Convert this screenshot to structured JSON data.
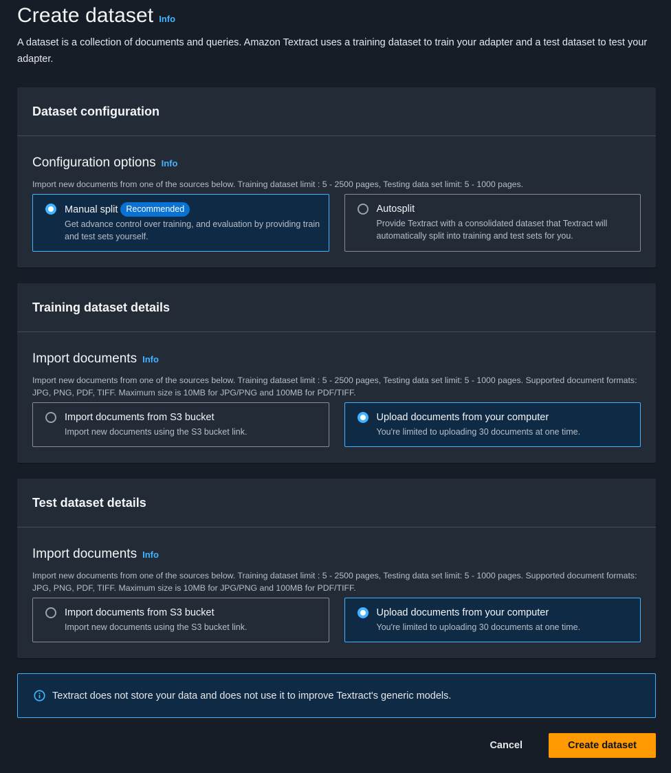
{
  "header": {
    "title": "Create dataset",
    "info": "Info",
    "description": "A dataset is a collection of documents and queries. Amazon Textract uses a training dataset to train your adapter and a test dataset to test your adapter."
  },
  "dataset_configuration": {
    "title": "Dataset configuration",
    "section_title": "Configuration options",
    "info": "Info",
    "description": "Import new documents from one of the sources below. Training dataset limit : 5 - 2500 pages, Testing data set limit: 5 - 1000 pages.",
    "options": [
      {
        "label": "Manual split",
        "badge": "Recommended",
        "description": "Get advance control over training, and evaluation by providing train and test sets yourself.",
        "selected": true
      },
      {
        "label": "Autosplit",
        "description": "Provide Textract with a consolidated dataset that Textract will automatically split into training and test sets for you.",
        "selected": false
      }
    ]
  },
  "training_dataset": {
    "title": "Training dataset details",
    "section_title": "Import documents",
    "info": "Info",
    "description": "Import new documents from one of the sources below. Training dataset limit : 5 - 2500 pages, Testing data set limit: 5 - 1000 pages. Supported document formats: JPG, PNG, PDF, TIFF. Maximum size is 10MB for JPG/PNG and 100MB for PDF/TIFF.",
    "options": [
      {
        "label": "Import documents from S3 bucket",
        "description": "Import new documents using the S3 bucket link.",
        "selected": false
      },
      {
        "label": "Upload documents from your computer",
        "description": "You're limited to uploading 30 documents at one time.",
        "selected": true
      }
    ]
  },
  "test_dataset": {
    "title": "Test dataset details",
    "section_title": "Import documents",
    "info": "Info",
    "description": "Import new documents from one of the sources below. Training dataset limit : 5 - 2500 pages, Testing data set limit: 5 - 1000 pages. Supported document formats: JPG, PNG, PDF, TIFF. Maximum size is 10MB for JPG/PNG and 100MB for PDF/TIFF.",
    "options": [
      {
        "label": "Import documents from S3 bucket",
        "description": "Import new documents using the S3 bucket link.",
        "selected": false
      },
      {
        "label": "Upload documents from your computer",
        "description": "You're limited to uploading 30 documents at one time.",
        "selected": true
      }
    ]
  },
  "alert": {
    "icon": "info-circle-icon",
    "text": "Textract does not store your data and does not use it to improve Textract's generic models."
  },
  "actions": {
    "cancel": "Cancel",
    "submit": "Create dataset"
  },
  "colors": {
    "background": "#161d26",
    "container": "#232b37",
    "accent": "#42b4ff",
    "primary_button": "#ff9900",
    "badge": "#0972d3"
  }
}
